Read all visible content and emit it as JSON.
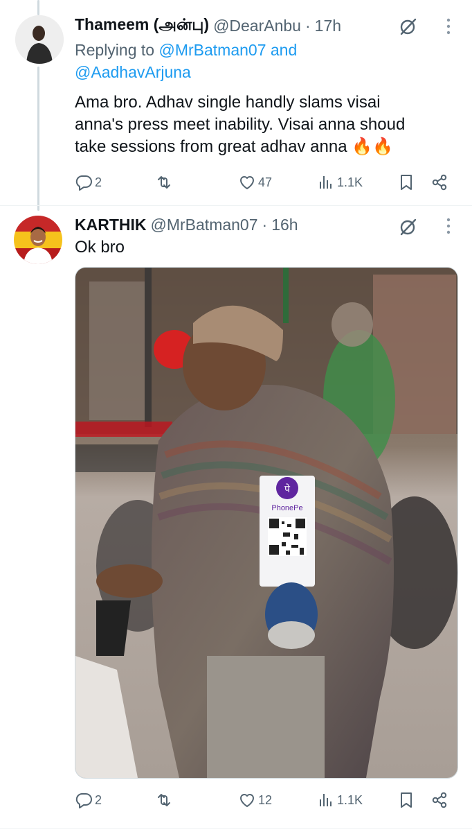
{
  "tweets": [
    {
      "display_name": "Thameem (அன்பு)",
      "handle": "@DearAnbu",
      "dot": "·",
      "time": "17h",
      "replying_label": "Replying to ",
      "replying_to_1": "@MrBatman07",
      "replying_and": " and",
      "replying_to_2": "@AadhavArjuna",
      "text_lines": [
        "Ama bro. Adhav single handly slams visai",
        "anna's press meet inability.  Visai anna shoud",
        "take sessions from great adhav anna 🔥🔥"
      ],
      "replies": "2",
      "retweets": "",
      "likes": "47",
      "views": "1.1K"
    },
    {
      "display_name": "KARTHIK",
      "handle": "@MrBatman07",
      "dot": "·",
      "time": "16h",
      "text": "Ok bro",
      "media_text": "PhonePe",
      "replies": "2",
      "retweets": "",
      "likes": "12",
      "views": "1.1K"
    }
  ],
  "colors": {
    "text": "#0f1419",
    "muted": "#536471",
    "link": "#1d9bf0",
    "thread_line": "#cfd9de",
    "phonepe_purple": "#5f259f"
  },
  "icons": [
    "grok-icon",
    "more-icon",
    "reply-icon",
    "retweet-icon",
    "like-icon",
    "views-icon",
    "bookmark-icon",
    "share-icon"
  ]
}
